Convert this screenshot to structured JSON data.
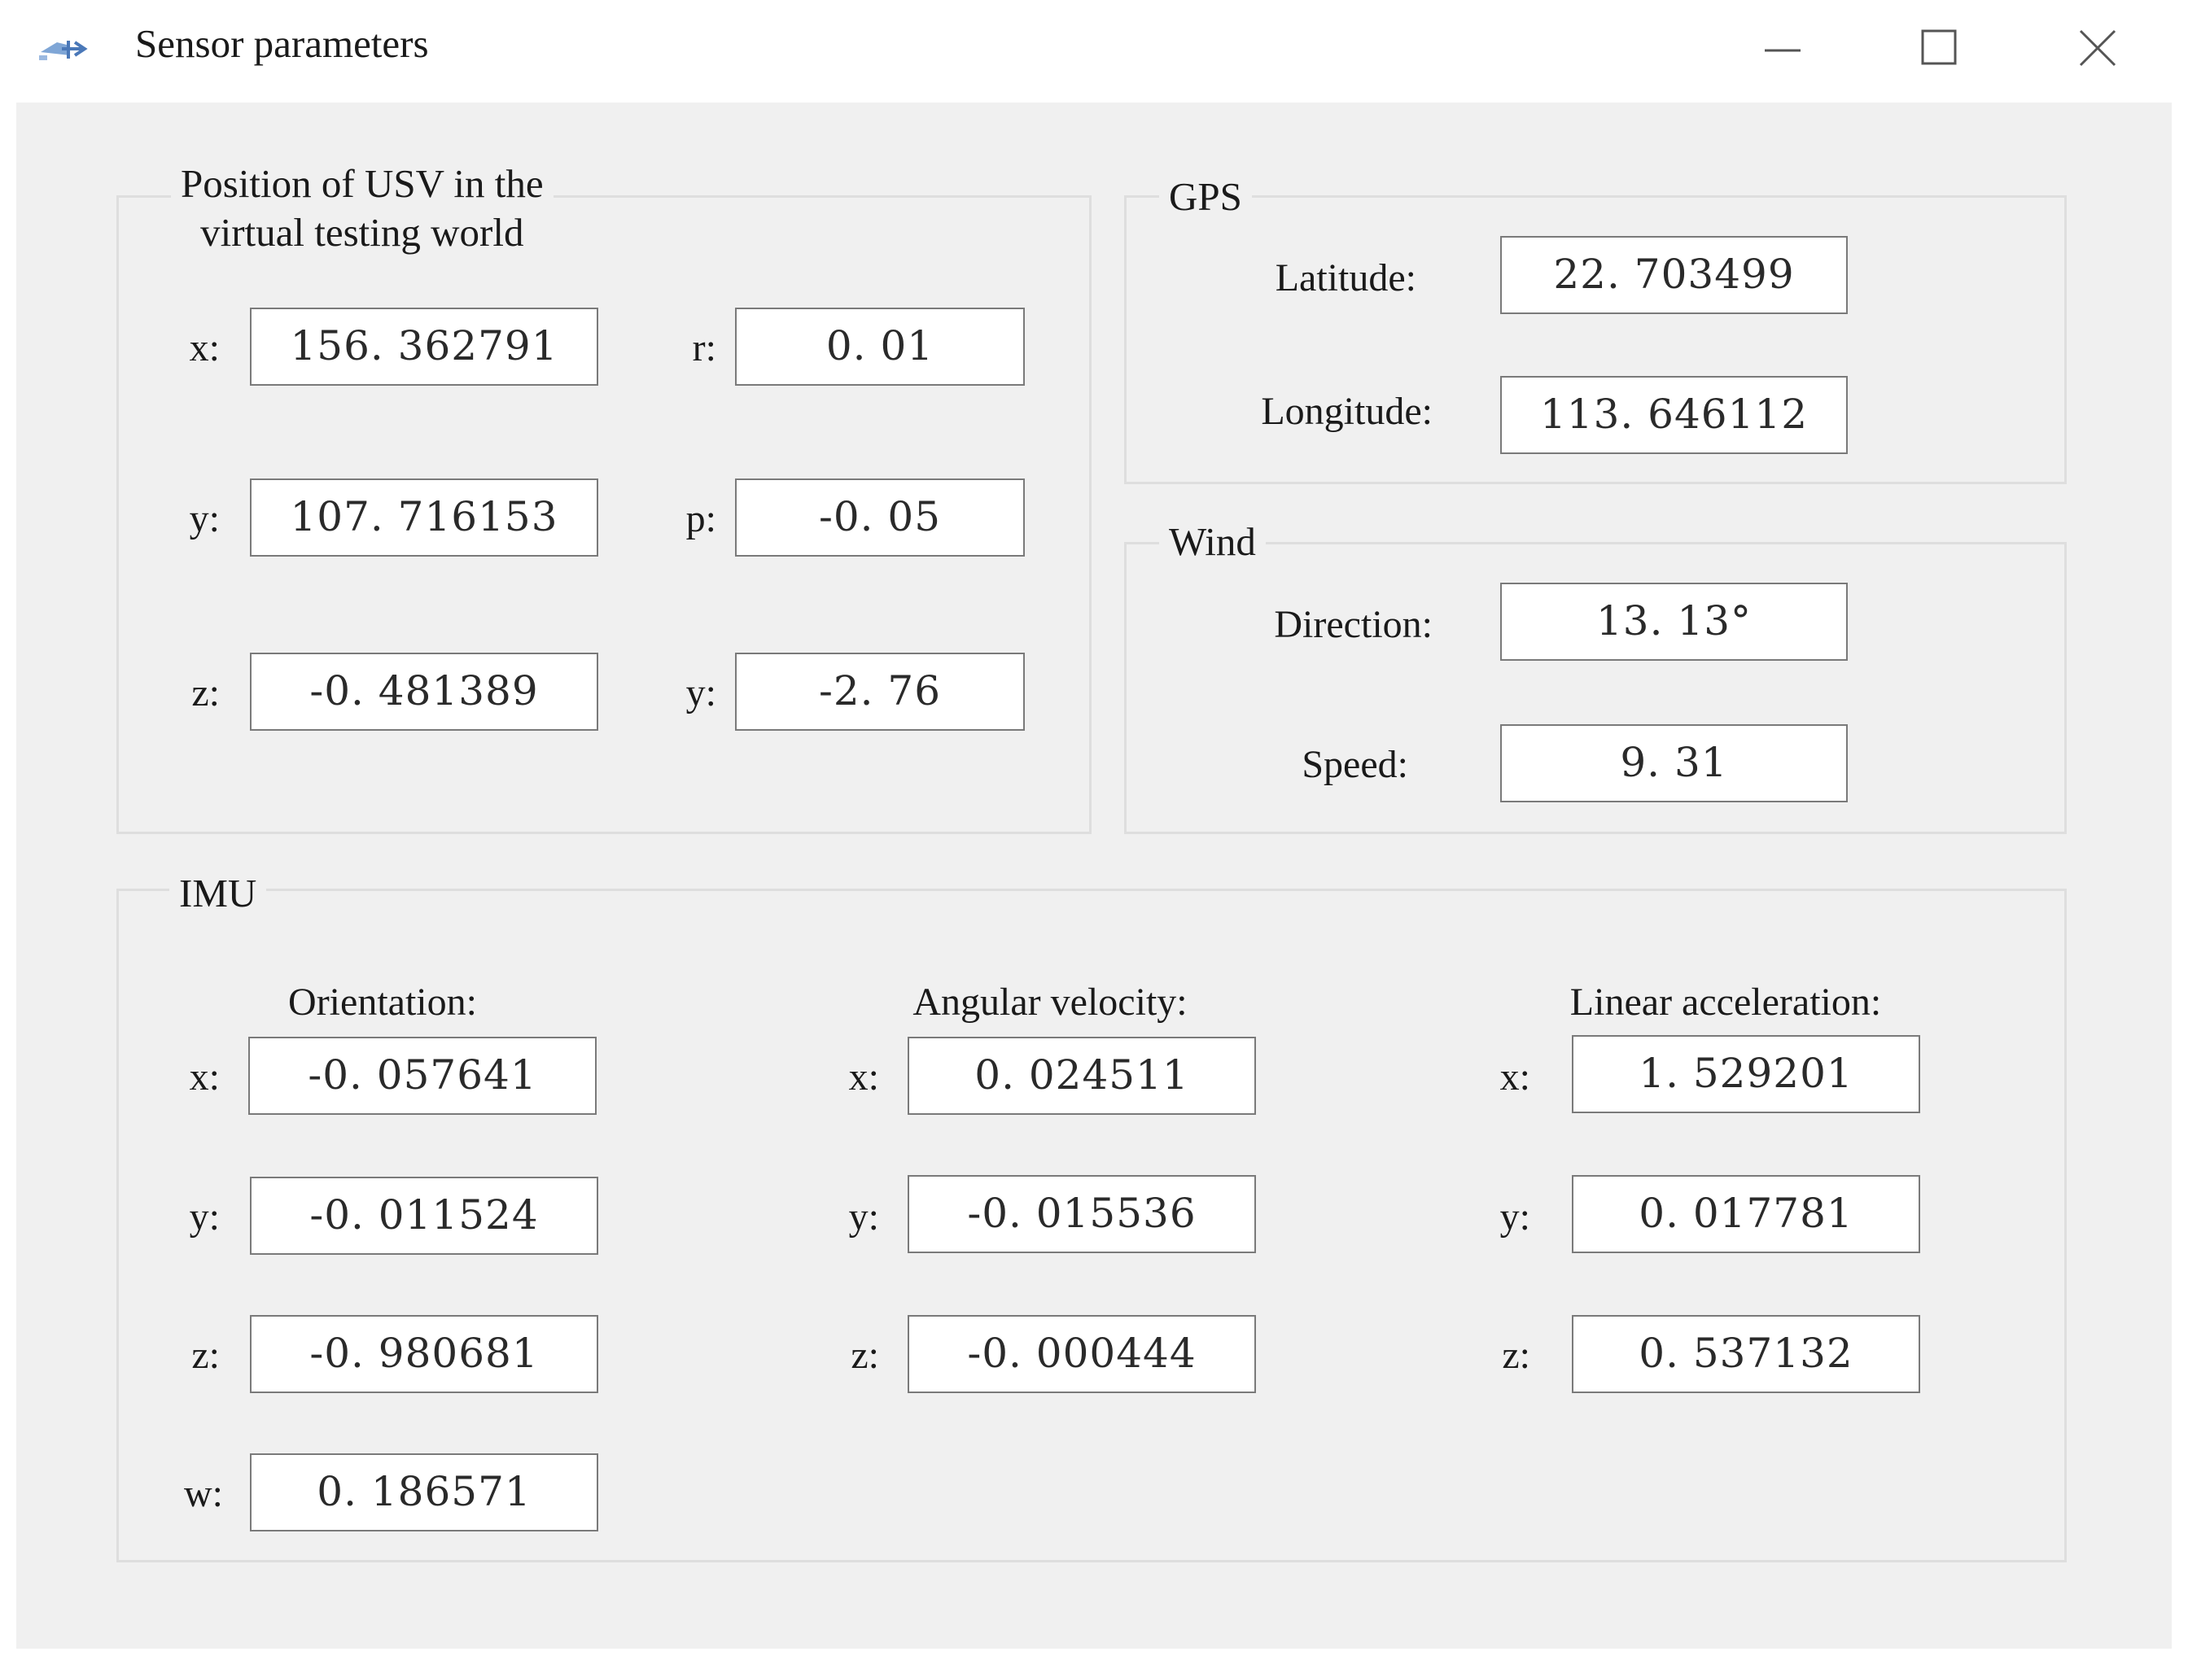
{
  "window": {
    "title": "Sensor parameters",
    "icon": "app-icon",
    "controls": [
      "minimize-icon",
      "maximize-icon",
      "close-icon"
    ]
  },
  "position": {
    "legend_line1": "Position of USV in the",
    "legend_line2": "virtual testing world",
    "x_label": "x:",
    "x_value": "156. 362791",
    "y_label": "y:",
    "y_value": "107. 716153",
    "z_label": "z:",
    "z_value": "-0. 481389",
    "r_label": "r:",
    "r_value": "0. 01",
    "p_label": "p:",
    "p_value": "-0. 05",
    "yaw_label": "y:",
    "yaw_value": "-2. 76"
  },
  "gps": {
    "legend": "GPS",
    "latitude_label": "Latitude:",
    "latitude_value": "22. 703499",
    "longitude_label": "Longitude:",
    "longitude_value": "113. 646112"
  },
  "wind": {
    "legend": "Wind",
    "direction_label": "Direction:",
    "direction_value": "13. 13°",
    "speed_label": "Speed:",
    "speed_value": "9. 31"
  },
  "imu": {
    "legend": "IMU",
    "orientation": {
      "header": "Orientation:",
      "x_label": "x:",
      "x_value": "-0. 057641",
      "y_label": "y:",
      "y_value": "-0. 011524",
      "z_label": "z:",
      "z_value": "-0. 980681",
      "w_label": "w:",
      "w_value": "0. 186571"
    },
    "angular_velocity": {
      "header": "Angular velocity:",
      "x_label": "x:",
      "x_value": "0. 024511",
      "y_label": "y:",
      "y_value": "-0. 015536",
      "z_label": "z:",
      "z_value": "-0. 000444"
    },
    "linear_acceleration": {
      "header": "Linear acceleration:",
      "x_label": "x:",
      "x_value": "1. 529201",
      "y_label": "y:",
      "y_value": "0. 017781",
      "z_label": "z:",
      "z_value": "0. 537132"
    }
  },
  "colors": {
    "window_bg": "#ffffff",
    "client_bg": "#f0f0f0",
    "groupbox_border": "#dedede",
    "field_border": "#7a7a7a",
    "text": "#1a1a1a"
  }
}
